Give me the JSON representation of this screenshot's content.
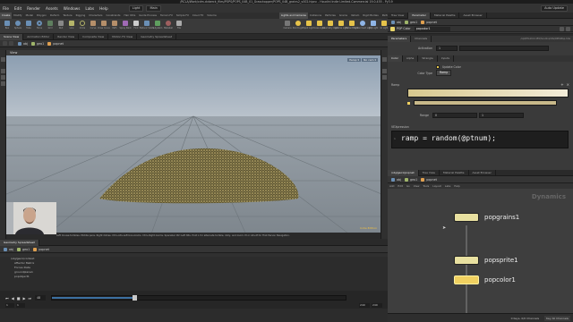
{
  "window": {
    "title": "/RCLA/Work/cdm-dvberck_files/POPS/POPS_04B_01_Grasshopper/POPS_04B_grains2_v002.hipnc - Houdini Indie Limited-Commercial 19.0.455 - Py3.9"
  },
  "menu": {
    "items": [
      "File",
      "Edit",
      "Render",
      "Assets",
      "Windows",
      "Labs",
      "Help"
    ],
    "desktop_combo": "Light",
    "main_combo": "Main",
    "build_combo": "Auto Update"
  },
  "shelf": {
    "left_tabs": [
      "Create",
      "Modify",
      "Model",
      "Polygon",
      "Deform",
      "Texture",
      "Rigging",
      "Characters",
      "Constraints",
      "Hair Utils",
      "Guide Process",
      "Terrain FX",
      "Simple FX",
      "Cloud FX",
      "Volume"
    ],
    "right_tabs": [
      "Lights and Cameras",
      "Collisions",
      "Particles",
      "Grains",
      "Vellum",
      "Rigid Bodies",
      "Particle Fluids",
      "Viscous Fluids",
      "Oceans",
      "Pyro FX",
      "FEM",
      "Wires",
      "Crowds",
      "Drive Simulation"
    ],
    "left_tools": [
      "Box",
      "Sphere",
      "Tube",
      "Torus",
      "Grid",
      "Null",
      "Line",
      "Circle",
      "Curve",
      "Draw Curve",
      "Path",
      "Spray Paint",
      "Font",
      "Platonic Solids",
      "L-System",
      "Metaball",
      "File"
    ],
    "right_tools": [
      "Camera",
      "Point Light",
      "Spot Light",
      "Area Light",
      "Geometry Light",
      "Volume Light",
      "Distant Light",
      "Environment Light",
      "Sky Light",
      "GI Light",
      "Caustic Light",
      "Portal Light",
      "Ambient Light",
      "Stereo Camera",
      "VR Camera",
      "Switcher"
    ]
  },
  "left_pane": {
    "tabs": [
      "Scene View",
      "Animation Editor",
      "Render View",
      "Composite View",
      "Motion FX View",
      "Geometry Spreadsheet"
    ],
    "path": [
      "obj",
      "geo1",
      "popnet"
    ],
    "viewport_label": "View",
    "persp_label": "Persp ▾",
    "cam_label": "No cam ▾",
    "indie_label": "Indie Edition",
    "status_hint": "Left mouse tumbles. Middle pans. Right dollies. Ctrl+Alt+Left box-zooms. Ctrl+Right zooms. Spacebar Ctrl Left tilts. Hold L for alternate tumble, dolly, and zoom.    M or Alt+M for First Person Navigation."
  },
  "bottom_left": {
    "tabs": [
      "Geometry Spreadsheet"
    ],
    "path": [
      "obj",
      "geo1",
      "popnet"
    ],
    "tree": [
      "/obj/geo1/context",
      "Affector Matrix",
      "Forces Data",
      "groundplane1",
      "popobject1"
    ],
    "frame": "1",
    "start": "1",
    "end": "240",
    "range_end": "240",
    "current_frame": "48"
  },
  "right_pane": {
    "top_tabs": [
      "Tree View",
      "Parameter",
      "Material Palette",
      "Asset Browser"
    ],
    "path": [
      "obj",
      "geo1",
      "popnet"
    ],
    "param_tabs": [
      "Parameters",
      "Channels"
    ],
    "node_type": "POP Color",
    "node_name": "popcolor1",
    "asset_path": "/opt/hfs19.0.455/houdini/otls/OPlibPop.hda",
    "subtabs": [
      "Color",
      "Alpha",
      "Wrangle",
      "Inputs"
    ],
    "activation_label": "Activation",
    "activation_value": "1",
    "update_color_label": "Update Color",
    "color_type_label": "Color Type",
    "color_type_value": "Ramp",
    "ramp_label": "Ramp",
    "range_label": "Range",
    "range_min": "0",
    "range_max": "1",
    "vex_label": "VEXpression",
    "vex_code": "ramp = random(@ptnum);",
    "net_tabs": [
      "/obj/geo1/popnet",
      "Tree View",
      "Material Palette",
      "Asset Browser"
    ],
    "net_menu": [
      "Add",
      "Edit",
      "Go",
      "View",
      "Tools",
      "Layout",
      "Labs",
      "Help"
    ],
    "dynamics_label": "Dynamics",
    "nodes": [
      {
        "name": "popgrains1",
        "color": "#e8e0a0"
      },
      {
        "name": "popsprite1",
        "color": "#e8e0a0"
      },
      {
        "name": "popcolor1",
        "color": "#f0d060"
      }
    ],
    "bottom_status": "0 Keys, 0/0 Channels",
    "key_all_label": "Key All Channels"
  },
  "colors": {
    "accent_yellow": "#f0d060",
    "ramp_start": "#d7c88e",
    "ramp_end": "#f3ecd9",
    "sky_top": "#8c9eb1",
    "ground": "#8f989f"
  }
}
